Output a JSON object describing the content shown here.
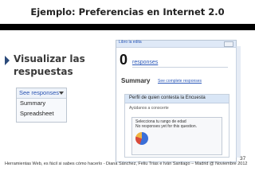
{
  "slide": {
    "title": "Ejemplo: Preferencias en Internet 2.0",
    "bullet": "Visualizar las respuestas",
    "page_number": "37",
    "footer": "Herramientas Web, es fácil si sabes cómo hacerlo - Diana Sánchez, Feliu Trias e Iván Santiago – Madrid @ Noviembre 2012"
  },
  "menu": {
    "header": "See responses",
    "items": [
      "Summary",
      "Spreadsheet"
    ]
  },
  "panel": {
    "top_link": "Libro la edita",
    "count": "0",
    "count_label": "responses",
    "summary_title": "Summary",
    "summary_link": "See complete responses",
    "card_title": "Perfil de quien contesta la Encuesta",
    "card_subtitle": "Ayúdanos a conocerte",
    "inner_line1": "Selecciona tu rango de edad",
    "inner_line2": "No responses yet for this question."
  },
  "colors": {
    "accent": "#2b58b8",
    "bullet": "#2b4a7a",
    "header_bg": "#d9e6f6"
  }
}
